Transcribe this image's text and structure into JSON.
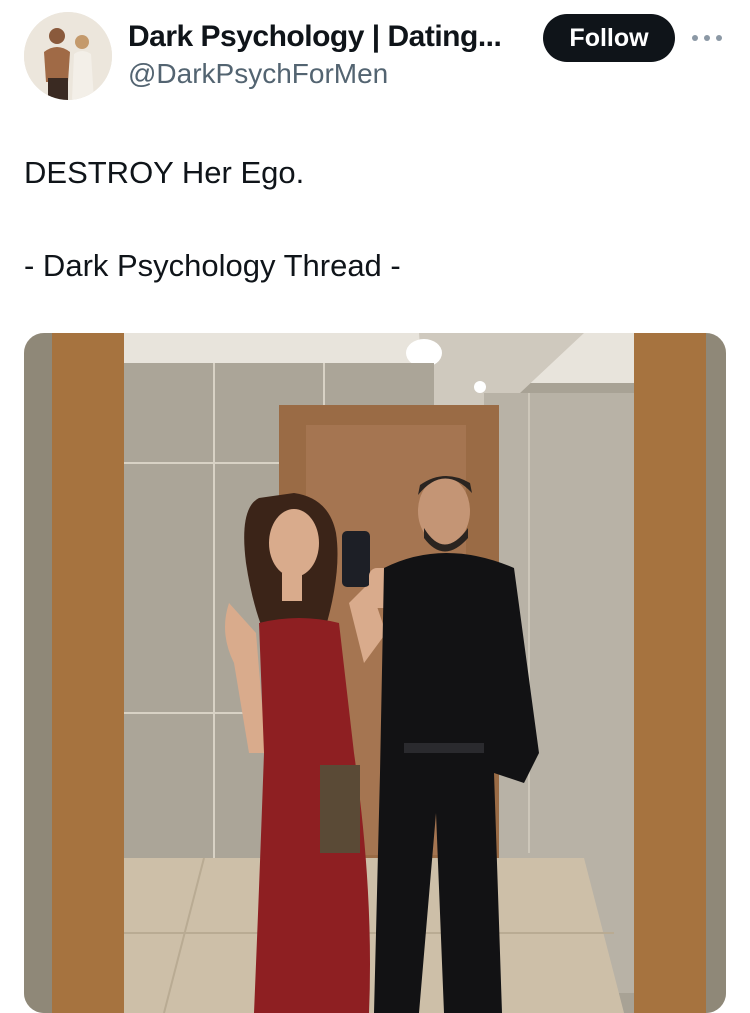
{
  "tweet": {
    "author": {
      "display_name": "Dark Psychology | Dating...",
      "handle": "@DarkPsychForMen"
    },
    "follow_label": "Follow",
    "more_icon": "more-horizontal-icon",
    "text_lines": [
      "DESTROY Her Ego.",
      "- Dark Psychology Thread -"
    ],
    "media": {
      "kind": "photo"
    }
  },
  "colors": {
    "text_primary": "#0f1419",
    "text_secondary": "#536471",
    "follow_button_bg": "#0f1419",
    "follow_button_text": "#ffffff"
  }
}
